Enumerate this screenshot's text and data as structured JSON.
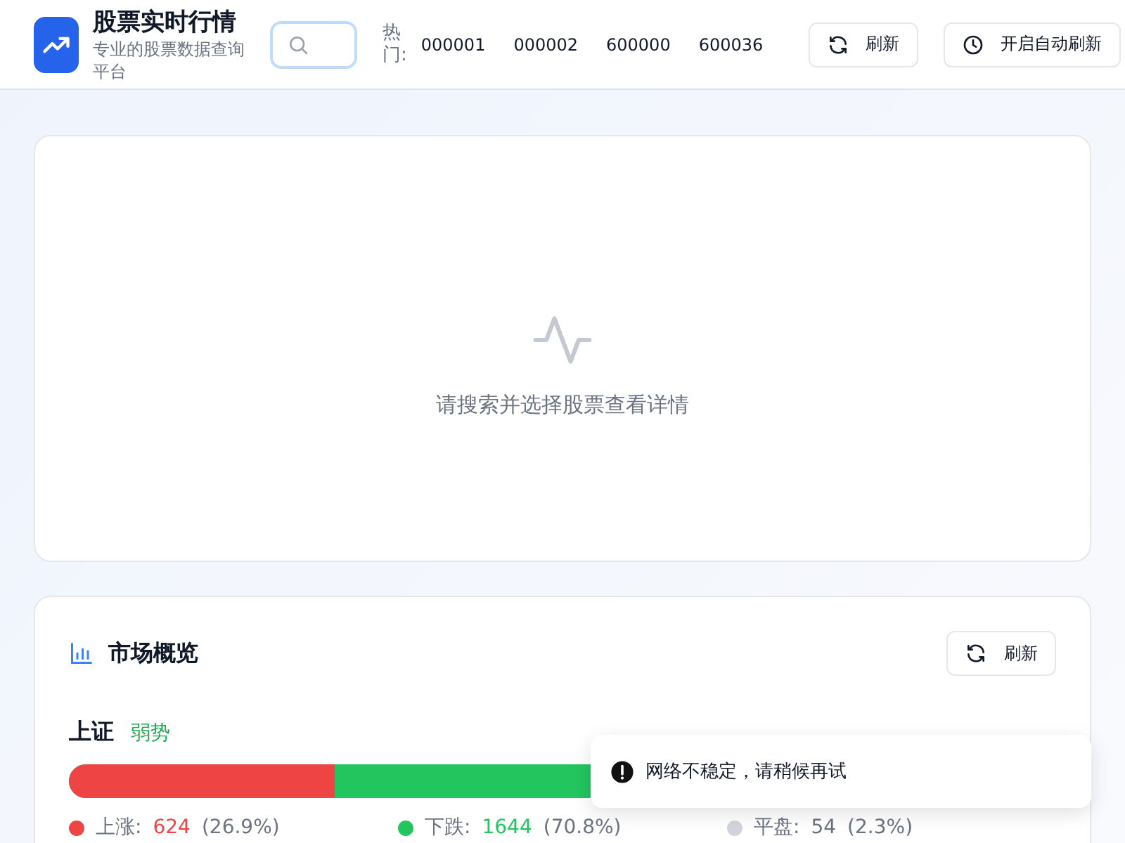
{
  "header": {
    "title": "股票实时行情",
    "subtitle": "专业的股票数据查询平台",
    "hot_label": "热门:",
    "hot_codes": [
      "000001",
      "000002",
      "600000",
      "600036"
    ],
    "buttons": [
      {
        "kind": "refresh",
        "label": "刷新"
      },
      {
        "kind": "clock",
        "label": "开启自动刷新"
      }
    ]
  },
  "detail": {
    "empty_text": "请搜索并选择股票查看详情"
  },
  "market": {
    "title": "市场概览",
    "refresh": "刷新",
    "indexes": [
      {
        "name": "上证",
        "trend": "弱势",
        "bearish": true,
        "level": 0.269,
        "stats": [
          {
            "label": "上涨:",
            "count": "624",
            "pct": "(26.9%)",
            "color": "#ef4444"
          },
          {
            "label": "下跌:",
            "count": "1644",
            "pct": "(70.8%)",
            "color": "#22c55e"
          },
          {
            "label": "平盘:",
            "count": "54",
            "pct": "(2.3%)",
            "color": "#d1d5db"
          }
        ]
      }
    ]
  },
  "toast": {
    "message": "网络不稳定，请稍候再试"
  }
}
